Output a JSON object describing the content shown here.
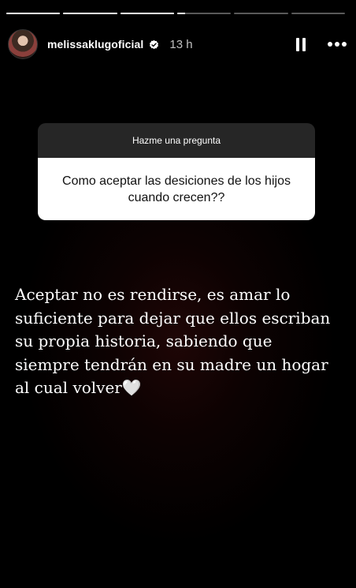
{
  "progress": [
    1,
    1,
    1,
    0.15,
    0,
    0
  ],
  "header": {
    "username": "melissaklugoficial",
    "time_ago": "13 h",
    "verified_icon": "verified-badge-icon",
    "pause_icon": "pause-icon",
    "more_icon": "more-options-icon"
  },
  "question": {
    "title": "Hazme una pregunta",
    "text": "Como aceptar las desiciones de los hijos cuando crecen??"
  },
  "caption": {
    "text": "Aceptar no es rendirse, es amar lo suficiente para dejar que ellos escriban su propia historia, sabiendo que siempre tendrán en su madre un hogar al cual volver🤍"
  },
  "colors": {
    "background": "#000000",
    "question_header": "#262626",
    "question_body": "#ffffff"
  }
}
